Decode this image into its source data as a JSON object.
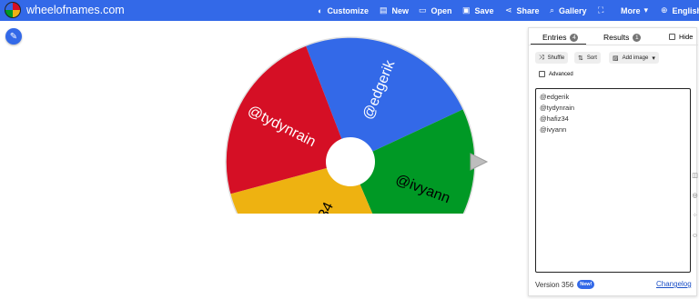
{
  "app": {
    "logo_text": "wheelofnames.com"
  },
  "menu": {
    "customize": "Customize",
    "new": "New",
    "open": "Open",
    "save": "Save",
    "share": "Share",
    "gallery": "Gallery",
    "more": "More",
    "language": "English"
  },
  "wheel": {
    "slices": [
      {
        "label": "@edgerik",
        "color": "#3369e8"
      },
      {
        "label": "@ivyann",
        "color": "#009925"
      },
      {
        "label": "@hafiz34",
        "color": "#eeb211"
      },
      {
        "label": "@tydynrain",
        "color": "#d50f25"
      }
    ]
  },
  "panel": {
    "tab_entries": "Entries",
    "entries_count": "4",
    "tab_results": "Results",
    "results_count": "1",
    "hide_label": "Hide",
    "shuffle_label": "Shuffle",
    "sort_label": "Sort",
    "add_image_label": "Add image",
    "advanced_label": "Advanced",
    "entries": [
      "@edgerik",
      "@tydynrain",
      "@hafiz34",
      "@ivyann"
    ],
    "version_text": "Version 356",
    "new_badge": "New!",
    "changelog": "Changelog"
  }
}
